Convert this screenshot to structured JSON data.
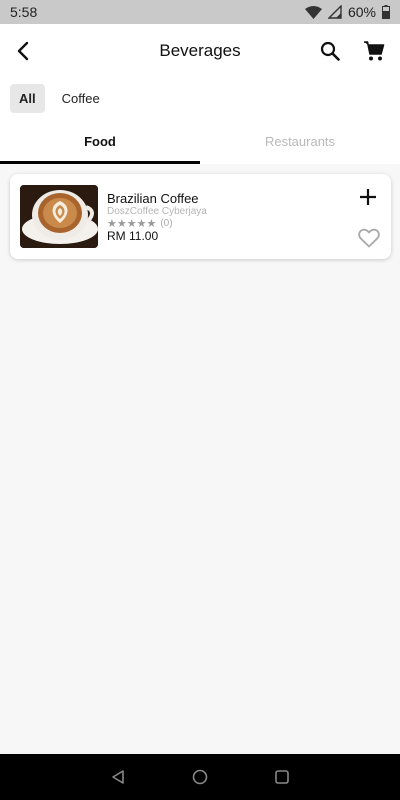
{
  "status_bar": {
    "time": "5:58",
    "battery": "60%",
    "icons": [
      "wifi-icon",
      "signal-icon",
      "battery-icon"
    ]
  },
  "app_bar": {
    "title": "Beverages",
    "icons": [
      "back-arrow-icon",
      "search-icon",
      "cart-icon"
    ]
  },
  "chips": [
    {
      "label": "All",
      "selected": true
    },
    {
      "label": "Coffee",
      "selected": false
    }
  ],
  "tabs": [
    {
      "label": "Food",
      "active": true
    },
    {
      "label": "Restaurants",
      "active": false
    }
  ],
  "items": [
    {
      "name": "Brazilian Coffee",
      "shop": "DoszCoffee Cyberjaya",
      "stars": "★★★★★",
      "rating_count": "(0)",
      "price": "RM 11.00",
      "image": "latte-art-coffee-cup"
    }
  ],
  "nav_bar": {
    "icons": [
      "back-triangle-icon",
      "home-circle-icon",
      "recents-square-icon"
    ]
  },
  "colors": {
    "accent": "#000000",
    "status_bar_bg": "#c9c9c9",
    "inactive_tab": "#b9b9b9",
    "page_bg": "#f7f7f7"
  }
}
